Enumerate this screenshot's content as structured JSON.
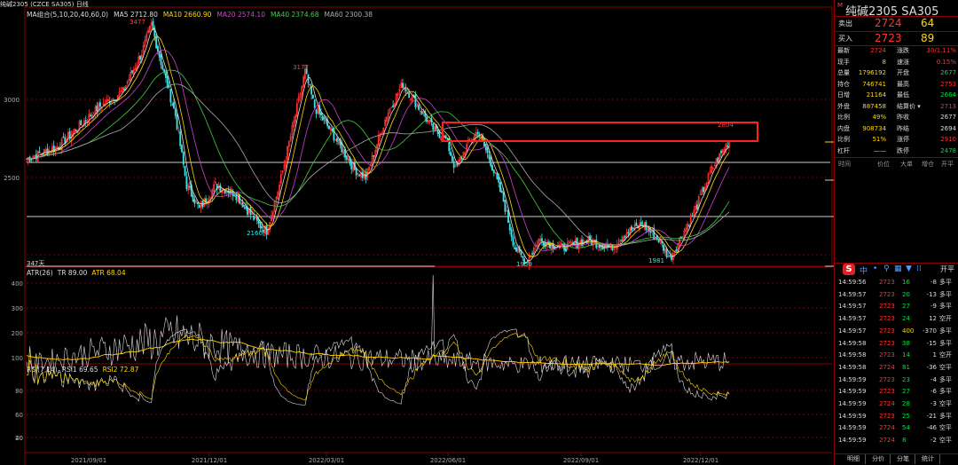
{
  "header": {
    "title": "纯碱2305",
    "code": "(CZCE SA305)",
    "period": "日线"
  },
  "main_legend": [
    {
      "label": "MA组合(5,10,20,40,60,0)",
      "color": "#dddddd"
    },
    {
      "label": "MA5 2712.80",
      "color": "#dddddd"
    },
    {
      "label": "MA10 2660.90",
      "color": "#ffd700"
    },
    {
      "label": "MA20 2574.10",
      "color": "#d040d0"
    },
    {
      "label": "MA40 2374.68",
      "color": "#40d040"
    },
    {
      "label": "MA60 2300.38",
      "color": "#aaaaaa"
    }
  ],
  "atr_legend": [
    {
      "label": "ATR(26)",
      "color": "#dddddd"
    },
    {
      "label": "TR 89.00",
      "color": "#dddddd"
    },
    {
      "label": "ATR 68.04",
      "color": "#ffd700"
    }
  ],
  "rsi_legend": [
    {
      "label": "RSI(7,14)",
      "color": "#dddddd"
    },
    {
      "label": "RSI1 69.65",
      "color": "#dddddd"
    },
    {
      "label": "RSI2 72.87",
      "color": "#ffd700"
    }
  ],
  "chart_data": {
    "type": "candlestick",
    "annotations": {
      "high1": "3477",
      "high2": "3177",
      "low1": "2160",
      "low2": "1959",
      "low3": "1981",
      "last_high": "2804",
      "bars_label": "347天"
    },
    "y_ticks_main": [
      "3000",
      "2500"
    ],
    "y_ticks_atr": [
      "400",
      "300",
      "200",
      "100"
    ],
    "y_ticks_rsi": [
      "80",
      "60",
      "40",
      "20"
    ],
    "x_ticks": [
      "2021/09/01",
      "2021/12/01",
      "2022/03/01",
      "2022/06/01",
      "2022/09/01",
      "2022/12/01"
    ],
    "key_points": [
      {
        "d": 0,
        "p": 2620
      },
      {
        "d": 20,
        "p": 2700
      },
      {
        "d": 45,
        "p": 2950
      },
      {
        "d": 60,
        "p": 3050
      },
      {
        "d": 72,
        "p": 3300
      },
      {
        "d": 78,
        "p": 3477
      },
      {
        "d": 85,
        "p": 3200
      },
      {
        "d": 93,
        "p": 2900
      },
      {
        "d": 100,
        "p": 2450
      },
      {
        "d": 108,
        "p": 2300
      },
      {
        "d": 118,
        "p": 2450
      },
      {
        "d": 130,
        "p": 2400
      },
      {
        "d": 145,
        "p": 2200
      },
      {
        "d": 150,
        "p": 2160
      },
      {
        "d": 158,
        "p": 2450
      },
      {
        "d": 168,
        "p": 2900
      },
      {
        "d": 174,
        "p": 3177
      },
      {
        "d": 180,
        "p": 2950
      },
      {
        "d": 190,
        "p": 2800
      },
      {
        "d": 205,
        "p": 2550
      },
      {
        "d": 212,
        "p": 2500
      },
      {
        "d": 225,
        "p": 2900
      },
      {
        "d": 235,
        "p": 3100
      },
      {
        "d": 245,
        "p": 2950
      },
      {
        "d": 255,
        "p": 2800
      },
      {
        "d": 262,
        "p": 2750
      },
      {
        "d": 268,
        "p": 2550
      },
      {
        "d": 275,
        "p": 2700
      },
      {
        "d": 282,
        "p": 2800
      },
      {
        "d": 290,
        "p": 2600
      },
      {
        "d": 298,
        "p": 2350
      },
      {
        "d": 305,
        "p": 2050
      },
      {
        "d": 312,
        "p": 1959
      },
      {
        "d": 320,
        "p": 2100
      },
      {
        "d": 335,
        "p": 2050
      },
      {
        "d": 350,
        "p": 2100
      },
      {
        "d": 365,
        "p": 2050
      },
      {
        "d": 375,
        "p": 2150
      },
      {
        "d": 385,
        "p": 2200
      },
      {
        "d": 395,
        "p": 2100
      },
      {
        "d": 402,
        "p": 1981
      },
      {
        "d": 408,
        "p": 2100
      },
      {
        "d": 418,
        "p": 2300
      },
      {
        "d": 428,
        "p": 2550
      },
      {
        "d": 438,
        "p": 2724
      }
    ]
  },
  "right_panel": {
    "title": "纯碱2305  SA305",
    "mark": "M",
    "sell": {
      "label": "卖出",
      "price": "2724",
      "vol": "64"
    },
    "buy": {
      "label": "买入",
      "price": "2723",
      "vol": "89"
    },
    "quotes": [
      {
        "l1": "最新",
        "v1": "2724",
        "c1": "#ff3333",
        "l2": "涨跌",
        "v2": "30/1.11%",
        "c2": "#ff3333"
      },
      {
        "l1": "现手",
        "v1": "8",
        "c1": "#ffd700",
        "l2": "速涨",
        "v2": "0.15%",
        "c2": "#ff3333"
      },
      {
        "l1": "总量",
        "v1": "1796192",
        "c1": "#ffd700",
        "l2": "开盘",
        "v2": "2677",
        "c2": "#00e040"
      },
      {
        "l1": "持仓",
        "v1": "746741",
        "c1": "#ffd700",
        "l2": "最高",
        "v2": "2753",
        "c2": "#ff3333"
      },
      {
        "l1": "日增",
        "v1": "21164",
        "c1": "#ffd700",
        "l2": "最低",
        "v2": "2664",
        "c2": "#00e040"
      },
      {
        "l1": "外盘",
        "v1": "887458",
        "c1": "#ffd700",
        "l2": "结算价 ▾",
        "v2": "2713",
        "c2": "#ff3333"
      },
      {
        "l1": "比例",
        "v1": "49%",
        "c1": "#ffd700",
        "l2": "昨收",
        "v2": "2677",
        "c2": "#dddddd"
      },
      {
        "l1": "内盘",
        "v1": "908734",
        "c1": "#ffd700",
        "l2": "昨结",
        "v2": "2694",
        "c2": "#dddddd"
      },
      {
        "l1": "比例",
        "v1": "51%",
        "c1": "#ffd700",
        "l2": "涨停",
        "v2": "2910",
        "c2": "#ff3333"
      },
      {
        "l1": "杠杆",
        "v1": "——",
        "c1": "#dddddd",
        "l2": "跌停",
        "v2": "2478",
        "c2": "#00e040"
      }
    ],
    "tick_header": [
      "时间",
      "价位",
      "大单",
      "增仓",
      "开平"
    ],
    "toolbar_right": "开平",
    "ticks": [
      {
        "t": "14:59:56",
        "p": "2723",
        "v": "16",
        "z": "-8",
        "k": "多平"
      },
      {
        "t": "14:59:57",
        "p": "2723",
        "v": "20",
        "z": "-13",
        "k": "多平"
      },
      {
        "t": "14:59:57",
        "p": "2723",
        "v": "27",
        "z": "-9",
        "k": "多平"
      },
      {
        "t": "14:59:57",
        "p": "2723",
        "v": "24",
        "z": "12",
        "k": "空开"
      },
      {
        "t": "14:59:57",
        "p": "2723",
        "v": "400",
        "z": "-370",
        "k": "多平"
      },
      {
        "t": "14:59:58",
        "p": "2723",
        "v": "38",
        "z": "-15",
        "k": "多平"
      },
      {
        "t": "14:59:58",
        "p": "2723",
        "v": "14",
        "z": "1",
        "k": "空开"
      },
      {
        "t": "14:59:58",
        "p": "2724",
        "v": "81",
        "z": "-36",
        "k": "空平"
      },
      {
        "t": "14:59:59",
        "p": "2723",
        "v": "23",
        "z": "-4",
        "k": "多平"
      },
      {
        "t": "14:59:59",
        "p": "2723",
        "v": "27",
        "z": "-6",
        "k": "多平"
      },
      {
        "t": "14:59:59",
        "p": "2724",
        "v": "28",
        "z": "-3",
        "k": "空平"
      },
      {
        "t": "14:59:59",
        "p": "2723",
        "v": "25",
        "z": "-21",
        "k": "多平"
      },
      {
        "t": "14:59:59",
        "p": "2724",
        "v": "54",
        "z": "-46",
        "k": "空平"
      },
      {
        "t": "14:59:59",
        "p": "2724",
        "v": "8",
        "z": "-2",
        "k": "空平"
      }
    ],
    "tabs": [
      "明细",
      "分价",
      "分笔",
      "统计"
    ]
  }
}
